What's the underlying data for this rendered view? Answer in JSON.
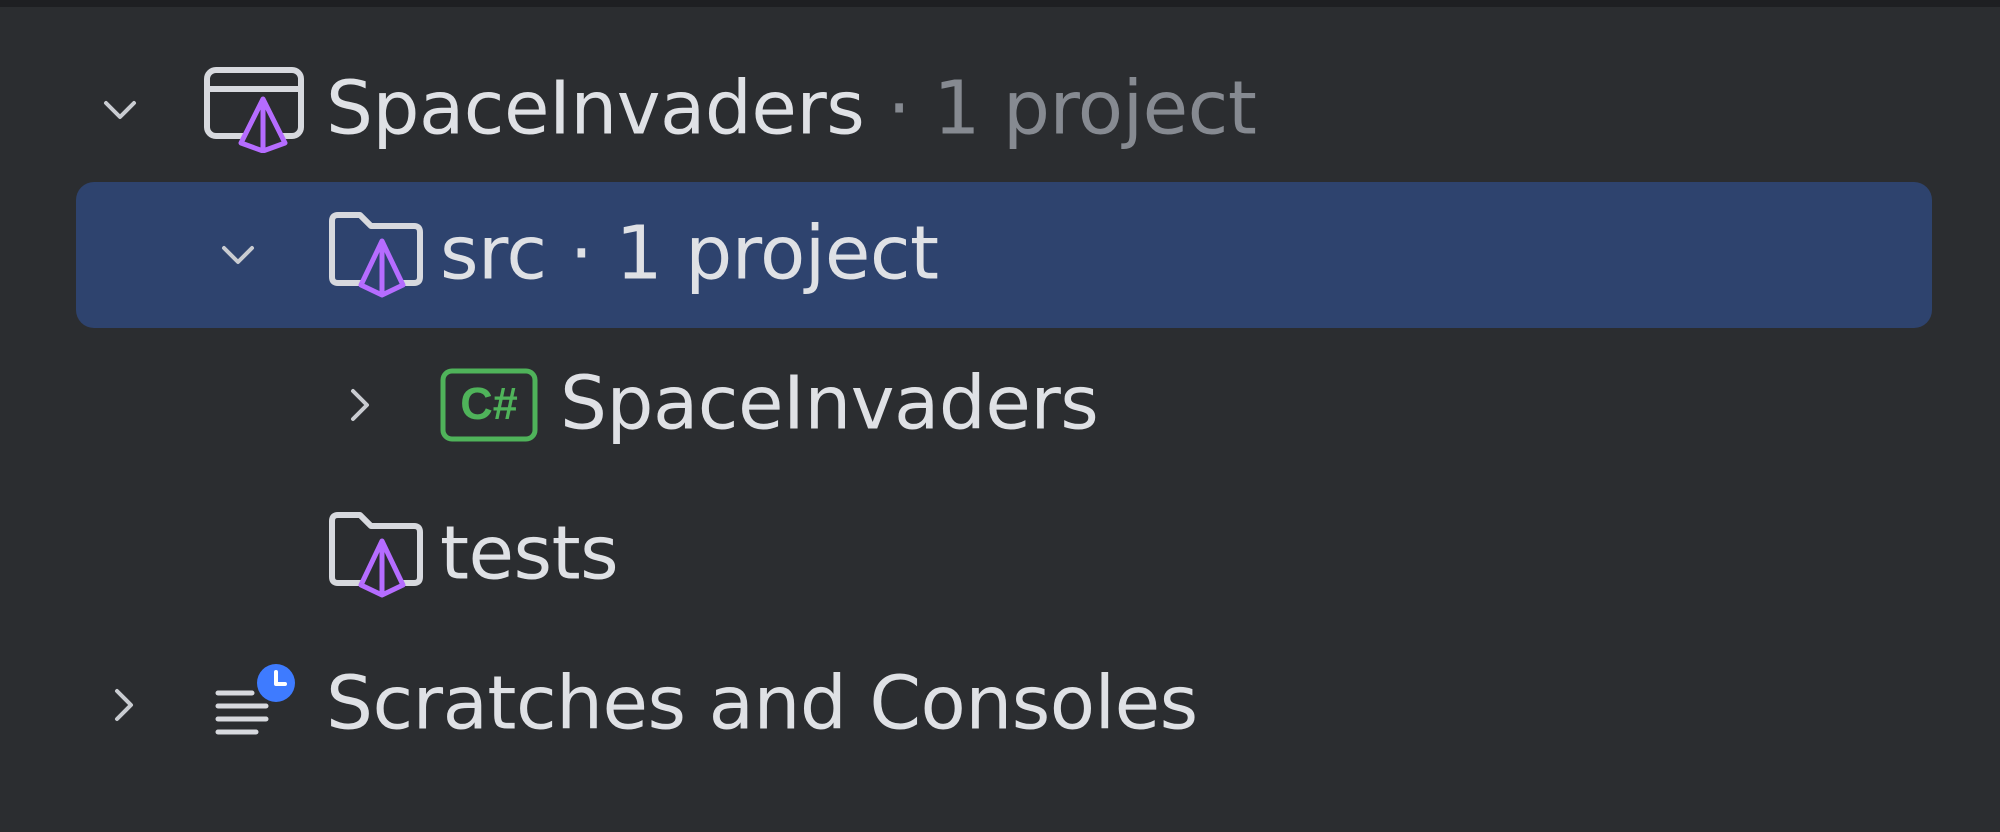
{
  "tree": {
    "items": [
      {
        "label": "SpaceInvaders",
        "meta": " · 1 project",
        "expanded": true,
        "icon": "solution-icon"
      },
      {
        "label": "src",
        "meta": " · 1 project",
        "expanded": true,
        "selected": true,
        "icon": "solution-folder-icon"
      },
      {
        "label": "SpaceInvaders",
        "expanded": false,
        "icon": "csharp-project-icon",
        "icon_text": "C#"
      },
      {
        "label": "tests",
        "icon": "solution-folder-icon"
      },
      {
        "label": "Scratches and Consoles",
        "expanded": false,
        "icon": "scratches-icon"
      }
    ]
  },
  "colors": {
    "background": "#2b2d30",
    "selection": "#2e436e",
    "text": "#dfe1e5",
    "muted_text": "#868a91",
    "accent_purple": "#b56cff",
    "csharp_green": "#4fb35a",
    "clock_blue": "#3e7bff"
  }
}
